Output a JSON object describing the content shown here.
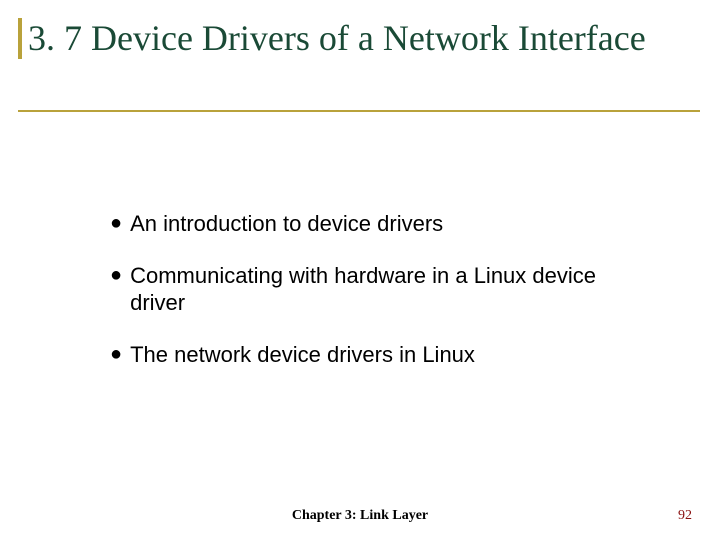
{
  "title": "3. 7 Device Drivers of a Network Interface",
  "bullets": [
    "An introduction to device drivers",
    "Communicating with hardware in a Linux device driver",
    "The network device drivers in Linux"
  ],
  "footer": {
    "chapter": "Chapter 3: Link Layer",
    "page": "92"
  },
  "bullet_glyph": "●"
}
